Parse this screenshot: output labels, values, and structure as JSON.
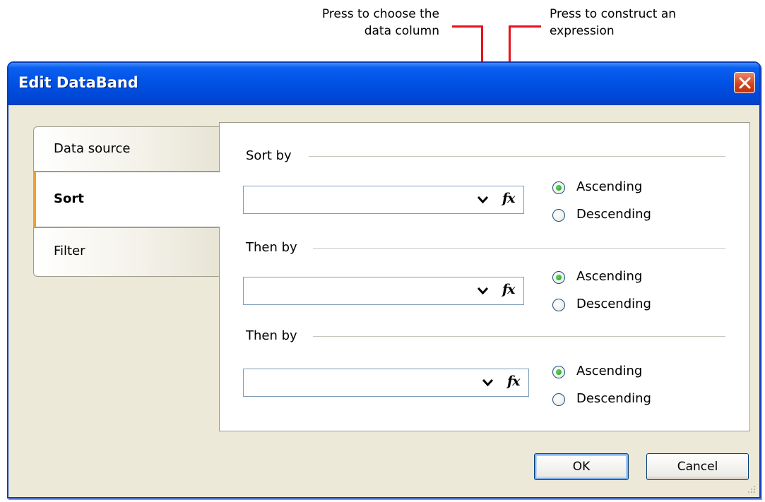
{
  "annotations": {
    "choose_column": [
      "Press to choose the",
      "data column"
    ],
    "construct_expression": [
      "Press to construct an",
      "expression"
    ],
    "line_color": "#e8101c"
  },
  "dialog": {
    "title": "Edit DataBand",
    "close_icon": "close-x-icon"
  },
  "tabs": [
    {
      "label": "Data source",
      "selected": false
    },
    {
      "label": "Sort",
      "selected": true
    },
    {
      "label": "Filter",
      "selected": false
    }
  ],
  "sort_sections": [
    {
      "label": "Sort by",
      "combo_value": "",
      "ascending_label": "Ascending",
      "descending_label": "Descending",
      "selected": "Ascending"
    },
    {
      "label": "Then by",
      "combo_value": "",
      "ascending_label": "Ascending",
      "descending_label": "Descending",
      "selected": "Ascending"
    },
    {
      "label": "Then by",
      "combo_value": "",
      "ascending_label": "Ascending",
      "descending_label": "Descending",
      "selected": "Ascending"
    }
  ],
  "expression_button_text": "fx",
  "buttons": {
    "ok": "OK",
    "cancel": "Cancel"
  },
  "colors": {
    "titlebar": "#0052e4",
    "dialog_bg": "#ece9d8",
    "selected_tab_accent": "#f0a030",
    "radio_dot": "#21a121"
  }
}
